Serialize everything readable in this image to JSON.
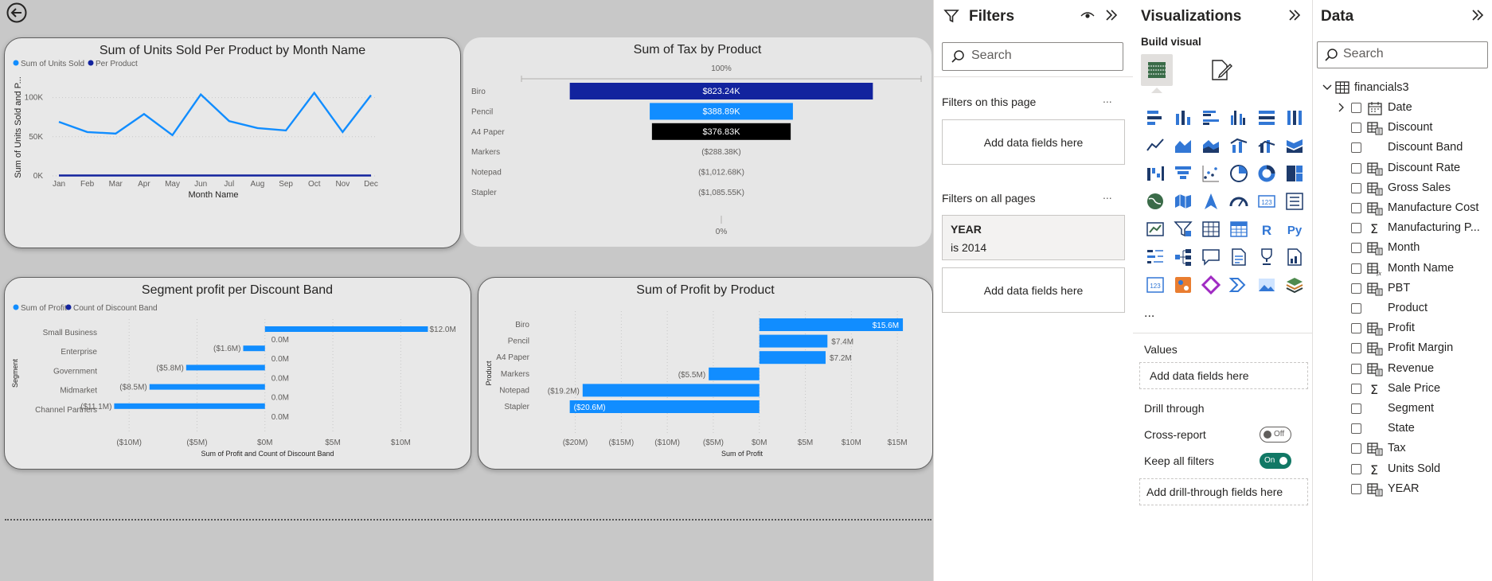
{
  "canvas": {
    "charts": [
      {
        "type": "line",
        "title": "Sum of Units Sold Per Product by Month Name",
        "series": [
          {
            "name": "Sum of Units Sold",
            "color": "#118dff",
            "values": [
              69000,
              56000,
              54000,
              79000,
              52000,
              104000,
              70000,
              61000,
              58000,
              106000,
              56000,
              103000
            ]
          },
          {
            "name": "Per Product",
            "color": "#12239e",
            "values": [
              500,
              500,
              500,
              500,
              500,
              500,
              500,
              500,
              500,
              500,
              500,
              500
            ]
          }
        ],
        "categories": [
          "Jan",
          "Feb",
          "Mar",
          "Apr",
          "May",
          "Jun",
          "Jul",
          "Aug",
          "Sep",
          "Oct",
          "Nov",
          "Dec"
        ],
        "xlabel": "Month Name",
        "ylabel": "Sum of Units Sold and P...",
        "yticks": [
          "0K",
          "50K",
          "100K"
        ],
        "ylim": [
          0,
          125000
        ],
        "legend": "top-left",
        "grid": true
      },
      {
        "type": "bar",
        "title": "Sum of Tax by Product",
        "categories": [
          "Biro",
          "Pencil",
          "A4 Paper",
          "Markers",
          "Notepad",
          "Stapler"
        ],
        "values": [
          823240,
          388890,
          376830,
          -288380,
          -1012680,
          -1085550
        ],
        "data_labels": [
          "$823.24K",
          "$388.89K",
          "$376.83K",
          "($288.38K)",
          "($1,012.68K)",
          "($1,085.55K)"
        ],
        "bar_colors": [
          "#12239e",
          "#118dff",
          "#000000",
          null,
          null,
          null
        ],
        "top_label": "100%",
        "bottom_label": "0%"
      },
      {
        "type": "bar",
        "title": "Segment profit per Discount Band",
        "categories": [
          "Small Business",
          "Enterprise",
          "Government",
          "Midmarket",
          "Channel Partners"
        ],
        "series": [
          {
            "name": "Sum of Profit",
            "color": "#118dff",
            "values": [
              12.0,
              -1.6,
              -5.8,
              -8.5,
              -11.1
            ],
            "labels": [
              "$12.0M",
              "($1.6M)",
              "($5.8M)",
              "($8.5M)",
              "($11.1M)"
            ]
          },
          {
            "name": "Count of Discount Band",
            "color": "#12239e",
            "values": [
              0,
              0,
              0,
              0,
              0
            ],
            "labels": [
              "0.0M",
              "0.0M",
              "0.0M",
              "0.0M",
              "0.0M"
            ]
          }
        ],
        "xticks": [
          "($10M)",
          "($5M)",
          "$0M",
          "$5M",
          "$10M"
        ],
        "xtick_values": [
          -10,
          -5,
          0,
          5,
          10
        ],
        "xlim": [
          -11.3,
          12.5
        ],
        "xlabel": "Sum of Profit and Count of Discount Band",
        "ylabel": "Segment",
        "legend": "top-left"
      },
      {
        "type": "bar",
        "title": "Sum of Profit by Product",
        "categories": [
          "Biro",
          "Pencil",
          "A4 Paper",
          "Markers",
          "Notepad",
          "Stapler"
        ],
        "values": [
          15.6,
          7.4,
          7.2,
          -5.5,
          -19.2,
          -20.6
        ],
        "data_labels": [
          "$15.6M",
          "$7.4M",
          "$7.2M",
          "($5.5M)",
          "($19.2M)",
          "($20.6M)"
        ],
        "color": "#118dff",
        "xticks": [
          "($20M)",
          "($15M)",
          "($10M)",
          "($5M)",
          "$0M",
          "$5M",
          "$10M",
          "$15M"
        ],
        "xtick_values": [
          -20,
          -15,
          -10,
          -5,
          0,
          5,
          10,
          15
        ],
        "xlim": [
          -21,
          16.2
        ],
        "xlabel": "Sum of Profit",
        "ylabel": "Product"
      }
    ]
  },
  "filters": {
    "title": "Filters",
    "search_placeholder": "Search",
    "on_this_page": "Filters on this page",
    "add_fields": "Add data fields here",
    "on_all_pages": "Filters on all pages",
    "card_title": "YEAR",
    "card_value": "is 2014",
    "more": "..."
  },
  "viz": {
    "title": "Visualizations",
    "build_visual": "Build visual",
    "more": "...",
    "values_label": "Values",
    "values_placeholder": "Add data fields here",
    "drill_through": "Drill through",
    "cross_report": "Cross-report",
    "cross_report_state": "Off",
    "keep_all_filters": "Keep all filters",
    "keep_all_state": "On",
    "drill_placeholder": "Add drill-through fields here",
    "r_label": "R",
    "py_label": "Py"
  },
  "data_pane": {
    "title": "Data",
    "search_placeholder": "Search",
    "table_name": "financials3",
    "fields": [
      {
        "name": "Date",
        "icon": "calendar-icon"
      },
      {
        "name": "Discount",
        "icon": "calc-table-icon"
      },
      {
        "name": "Discount Band",
        "icon": "none"
      },
      {
        "name": "Discount Rate",
        "icon": "calc-table-icon"
      },
      {
        "name": "Gross Sales",
        "icon": "calc-table-icon"
      },
      {
        "name": "Manufacture Cost",
        "icon": "calc-table-icon"
      },
      {
        "name": "Manufacturing P...",
        "icon": "sigma-icon"
      },
      {
        "name": "Month",
        "icon": "calc-table-icon"
      },
      {
        "name": "Month Name",
        "icon": "fx-table-icon"
      },
      {
        "name": "PBT",
        "icon": "calc-table-icon"
      },
      {
        "name": "Product",
        "icon": "none"
      },
      {
        "name": "Profit",
        "icon": "calc-table-icon"
      },
      {
        "name": "Profit Margin",
        "icon": "calc-table-icon"
      },
      {
        "name": "Revenue",
        "icon": "calc-table-icon"
      },
      {
        "name": "Sale Price",
        "icon": "sigma-icon"
      },
      {
        "name": "Segment",
        "icon": "none"
      },
      {
        "name": "State",
        "icon": "none"
      },
      {
        "name": "Tax",
        "icon": "calc-table-icon"
      },
      {
        "name": "Units Sold",
        "icon": "sigma-icon"
      },
      {
        "name": "YEAR",
        "icon": "calc-table-icon"
      }
    ]
  }
}
